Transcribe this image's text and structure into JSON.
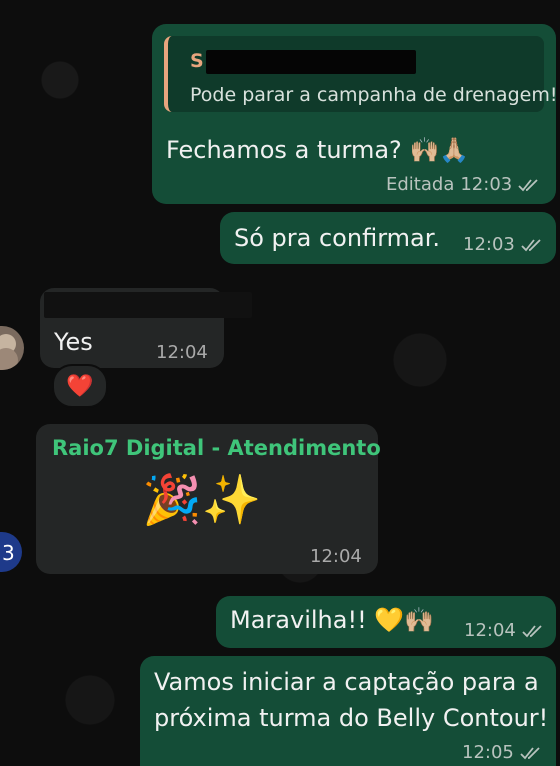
{
  "messages": {
    "m1": {
      "quote_initial": "S",
      "quote_text": "Pode parar a campanha de drenagem!",
      "text": "Fechamos a turma?",
      "emoji": "🙌🏼🙏🏼",
      "edited_label": "Editada",
      "time": "12:03"
    },
    "m2": {
      "text": "Só pra confirmar.",
      "time": "12:03"
    },
    "m3": {
      "text": "Yes",
      "time": "12:04",
      "reaction": "❤️"
    },
    "m4": {
      "sender": "Raio7 Digital - Atendimento",
      "emoji": "🎉✨",
      "time": "12:04"
    },
    "m5": {
      "text": "Maravilha!!",
      "emoji": "💛🙌🏼",
      "time": "12:04"
    },
    "m6": {
      "line1": "Vamos iniciar a captação para a",
      "line2": "próxima turma do Belly Contour!",
      "time": "12:05"
    }
  },
  "colors": {
    "outgoing_bubble": "#144d37",
    "incoming_bubble": "#242626",
    "quote_accent": "#e8a57e",
    "sender_name": "#3fc57a"
  },
  "icons": {
    "read_receipt": "double-check-icon",
    "avatar": "avatar-icon"
  }
}
